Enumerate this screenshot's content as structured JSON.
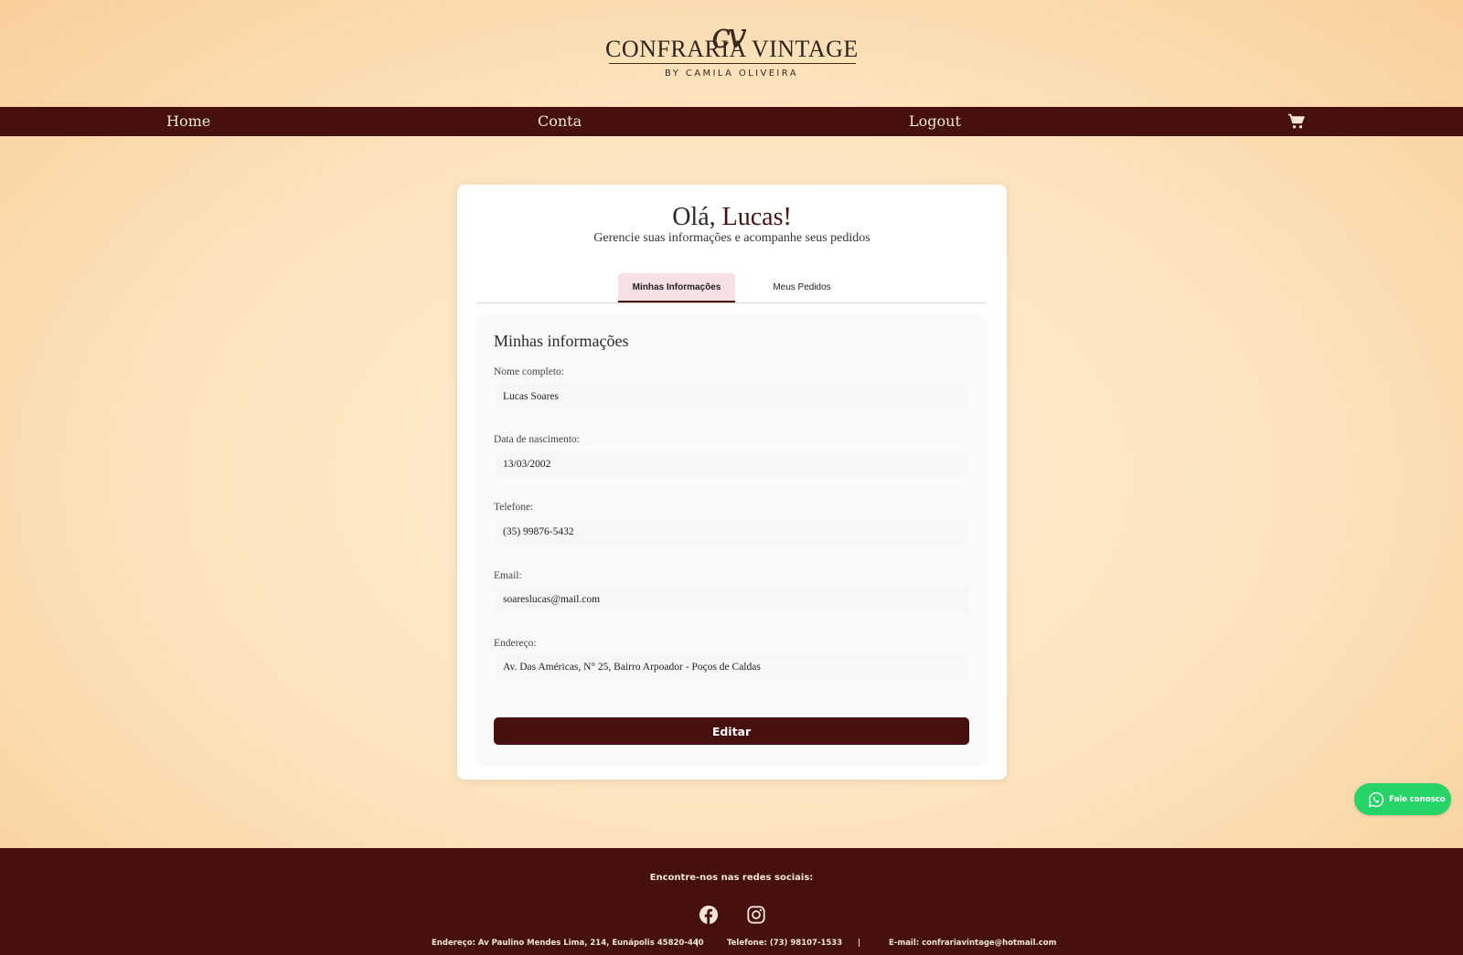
{
  "brand": {
    "monogram": "cv",
    "name": "CONFRARIA VINTAGE",
    "tagline": "BY CAMILA OLIVEIRA",
    "accent_color": "#46100e"
  },
  "nav": {
    "home": "Home",
    "account": "Conta",
    "logout": "Logout",
    "cart_icon": "shopping-cart-icon"
  },
  "profile": {
    "greeting_prefix": "Olá, ",
    "greeting_name": "Lucas!",
    "subtitle": "Gerencie suas informações e acompanhe seus pedidos",
    "tabs": [
      {
        "label": "Minhas Informações",
        "active": true
      },
      {
        "label": "Meus Pedidos",
        "active": false
      }
    ],
    "section_title": "Minhas informações",
    "fields": [
      {
        "label": "Nome completo:",
        "value": "Lucas Soares"
      },
      {
        "label": "Data de nascimento:",
        "value": "13/03/2002"
      },
      {
        "label": "Telefone:",
        "value": "(35) 99876-5432"
      },
      {
        "label": "Email:",
        "value": "soareslucas@mail.com"
      },
      {
        "label": "Endereço:",
        "value": "Av. Das Américas, N° 25, Bairro Arpoador - Poços de Caldas"
      }
    ],
    "edit_label": "Editar"
  },
  "whatsapp": {
    "label": "Fale conosco",
    "icon": "whatsapp-icon",
    "color": "#25d366"
  },
  "footer": {
    "social_title": "Encontre-nos nas redes sociais:",
    "social_icons": [
      "facebook-icon",
      "instagram-icon"
    ],
    "address": "Endereço: Av Paulino Mendes Lima, 214, Eunápolis 45820-440",
    "separator": "|",
    "phone": "Telefone: (73) 98107-1533",
    "email": "E-mail: confrariavintage@hotmail.com"
  }
}
